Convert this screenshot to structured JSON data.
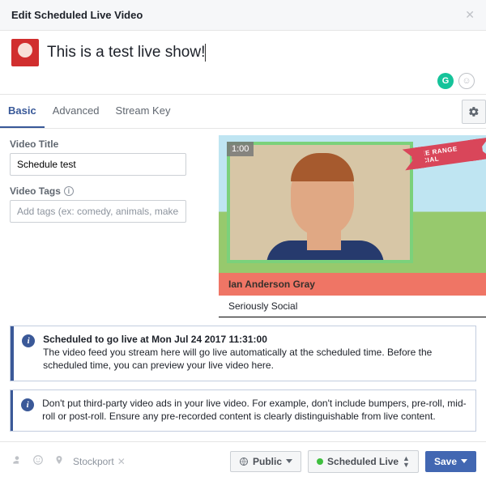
{
  "header": {
    "title": "Edit Scheduled Live Video"
  },
  "composer": {
    "status_text": "This is a test live show!"
  },
  "tabs": {
    "basic": "Basic",
    "advanced": "Advanced",
    "stream_key": "Stream Key"
  },
  "form": {
    "video_title_label": "Video Title",
    "video_title_value": "Schedule test",
    "video_tags_label": "Video Tags",
    "video_tags_placeholder": "Add tags (ex: comedy, animals, make-up etc.)"
  },
  "preview": {
    "timer": "1:00",
    "ribbon": "FREE RANGE SOCIAL",
    "name": "Ian Anderson Gray",
    "org": "Seriously Social"
  },
  "info1": {
    "headline": "Scheduled to go live at Mon Jul 24 2017 11:31:00",
    "body": "The video feed you stream here will go live automatically at the scheduled time. Before the scheduled time, you can preview your live video here."
  },
  "info2": {
    "body": "Don't put third-party video ads in your live video. For example, don't include bumpers, pre-roll, mid-roll or post-roll. Ensure any pre-recorded content is clearly distinguishable from live content."
  },
  "footer": {
    "location": "Stockport",
    "audience_label": "Public",
    "scheduled_label": "Scheduled Live",
    "save_label": "Save"
  }
}
